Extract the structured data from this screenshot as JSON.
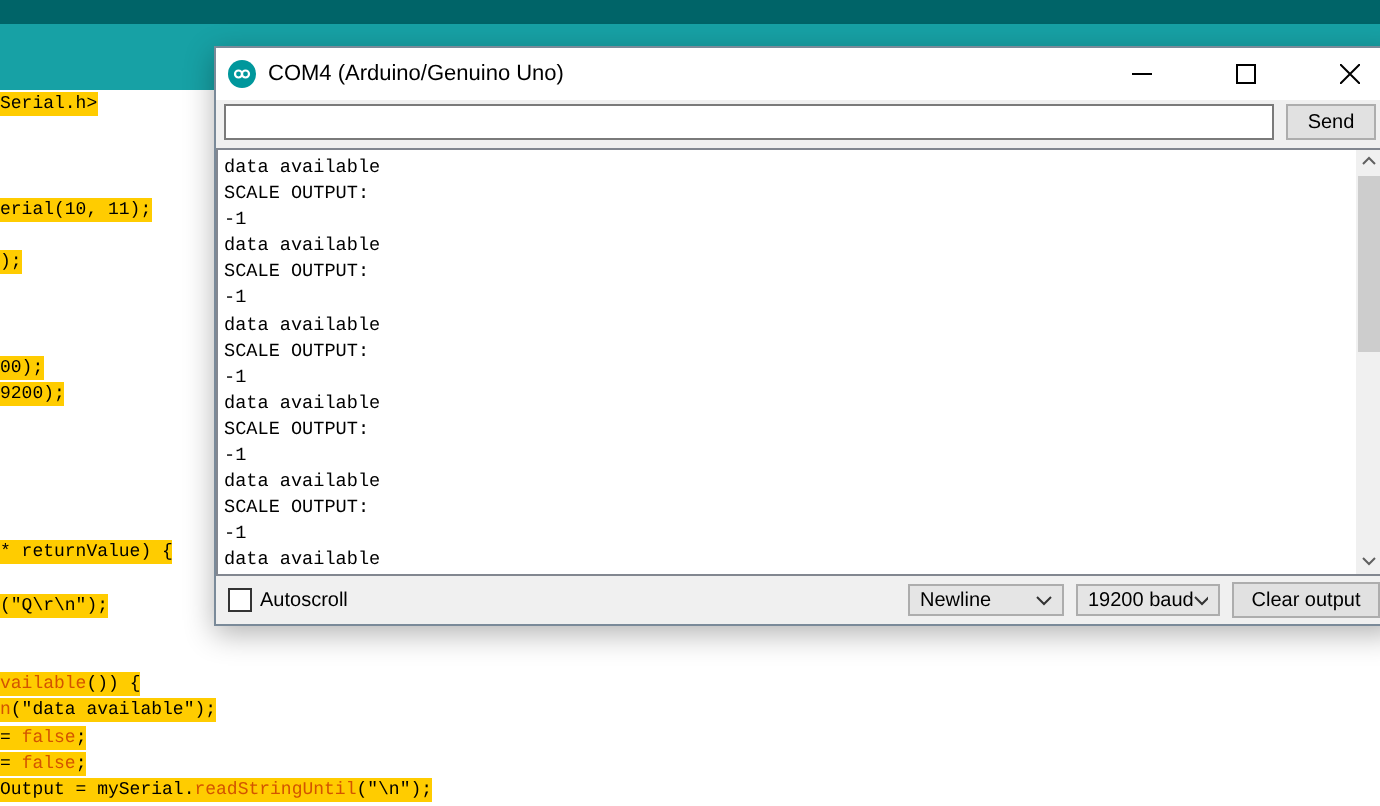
{
  "editor": {
    "lines": [
      {
        "kind": "code",
        "highlighted": true,
        "segments": [
          {
            "text": "Serial.h>",
            "kind": "plain"
          }
        ]
      },
      {
        "kind": "blank"
      },
      {
        "kind": "blank"
      },
      {
        "kind": "blank"
      },
      {
        "kind": "code",
        "highlighted": true,
        "segments": [
          {
            "text": "erial(10, 11);",
            "kind": "plain"
          }
        ]
      },
      {
        "kind": "blank"
      },
      {
        "kind": "code",
        "highlighted": true,
        "segments": [
          {
            "text": ");",
            "kind": "plain"
          }
        ]
      },
      {
        "kind": "blank"
      },
      {
        "kind": "blank"
      },
      {
        "kind": "blank"
      },
      {
        "kind": "code",
        "highlighted": true,
        "segments": [
          {
            "text": "00);",
            "kind": "plain"
          }
        ]
      },
      {
        "kind": "code",
        "highlighted": true,
        "segments": [
          {
            "text": "9200);",
            "kind": "plain"
          }
        ]
      },
      {
        "kind": "blank"
      },
      {
        "kind": "blank"
      },
      {
        "kind": "blank"
      },
      {
        "kind": "blank"
      },
      {
        "kind": "blank"
      },
      {
        "kind": "code",
        "highlighted": true,
        "segments": [
          {
            "text": "* returnValue) {",
            "kind": "plain"
          }
        ]
      },
      {
        "kind": "blank"
      },
      {
        "kind": "code",
        "highlighted": true,
        "segments": [
          {
            "text": "(\"Q\\r\\n\");",
            "kind": "plain"
          }
        ]
      },
      {
        "kind": "blank"
      },
      {
        "kind": "blank"
      },
      {
        "kind": "code",
        "highlighted": true,
        "segments": [
          {
            "text": "vailable",
            "kind": "keyword"
          },
          {
            "text": "()) {",
            "kind": "plain"
          }
        ]
      },
      {
        "kind": "code",
        "highlighted": true,
        "segments": [
          {
            "text": "n",
            "kind": "keyword"
          },
          {
            "text": "(\"data available\");",
            "kind": "plain"
          }
        ]
      },
      {
        "kind": "code",
        "highlighted": true,
        "segments": [
          {
            "text": "= ",
            "kind": "plain"
          },
          {
            "text": "false",
            "kind": "keyword"
          },
          {
            "text": ";",
            "kind": "plain"
          }
        ]
      },
      {
        "kind": "code",
        "highlighted": true,
        "segments": [
          {
            "text": "= ",
            "kind": "plain"
          },
          {
            "text": "false",
            "kind": "keyword"
          },
          {
            "text": ";",
            "kind": "plain"
          }
        ]
      },
      {
        "kind": "code",
        "highlighted": true,
        "segments": [
          {
            "text": "Output = mySerial.",
            "kind": "plain"
          },
          {
            "text": "readStringUntil",
            "kind": "keyword"
          },
          {
            "text": "(\"\\n\");",
            "kind": "plain"
          }
        ]
      }
    ]
  },
  "window": {
    "title": "COM4 (Arduino/Genuino Uno)",
    "send_button": "Send",
    "output": [
      "data available",
      "SCALE OUTPUT:",
      "-1",
      "data available",
      "SCALE OUTPUT:",
      "-1",
      "data available",
      "SCALE OUTPUT:",
      "-1",
      "data available",
      "SCALE OUTPUT:",
      "-1",
      "data available",
      "SCALE OUTPUT:",
      "-1",
      "data available"
    ],
    "autoscroll": {
      "label": "Autoscroll",
      "checked": false
    },
    "line_ending": "Newline",
    "baud_rate": "19200 baud",
    "clear_button": "Clear output"
  }
}
